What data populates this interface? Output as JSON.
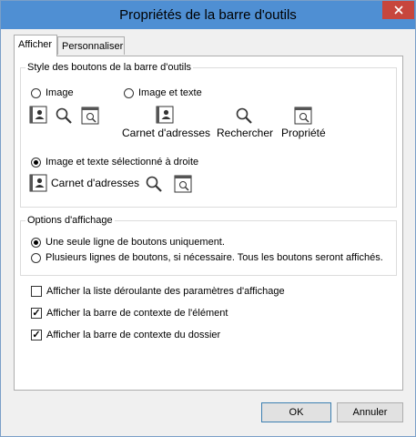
{
  "window": {
    "title": "Propriétés de la barre d'outils"
  },
  "tabs": [
    {
      "label": "Afficher"
    },
    {
      "label": "Personnaliser"
    }
  ],
  "button_style_group": {
    "legend": "Style des boutons de la barre d'outils",
    "option_image": "Image",
    "option_image_text": "Image et texte",
    "option_image_text_right": "Image et texte sélectionné à droite",
    "selected": "Image et texte sélectionné à droite",
    "preview_labels": {
      "address_book": "Carnet d'adresses",
      "search": "Rechercher",
      "properties": "Propriété"
    }
  },
  "display_options_group": {
    "legend": "Options d'affichage",
    "option_single_line": "Une seule ligne de boutons uniquement.",
    "option_multi_line": "Plusieurs lignes de boutons, si nécessaire. Tous les boutons seront affichés.",
    "selected": "Une seule ligne de boutons uniquement."
  },
  "checkboxes": [
    {
      "label": "Afficher la liste déroulante des paramètres d'affichage",
      "checked": false
    },
    {
      "label": "Afficher la barre de contexte de l'élément",
      "checked": true
    },
    {
      "label": "Afficher la barre de contexte du dossier",
      "checked": true
    }
  ],
  "buttons": {
    "ok": "OK",
    "cancel": "Annuler"
  },
  "icons": {
    "close": "close-icon",
    "address_book": "address-book-icon",
    "search": "magnifier-icon",
    "properties": "properties-icon"
  },
  "colors": {
    "titlebar": "#4f8fd3",
    "close": "#c7463d"
  }
}
